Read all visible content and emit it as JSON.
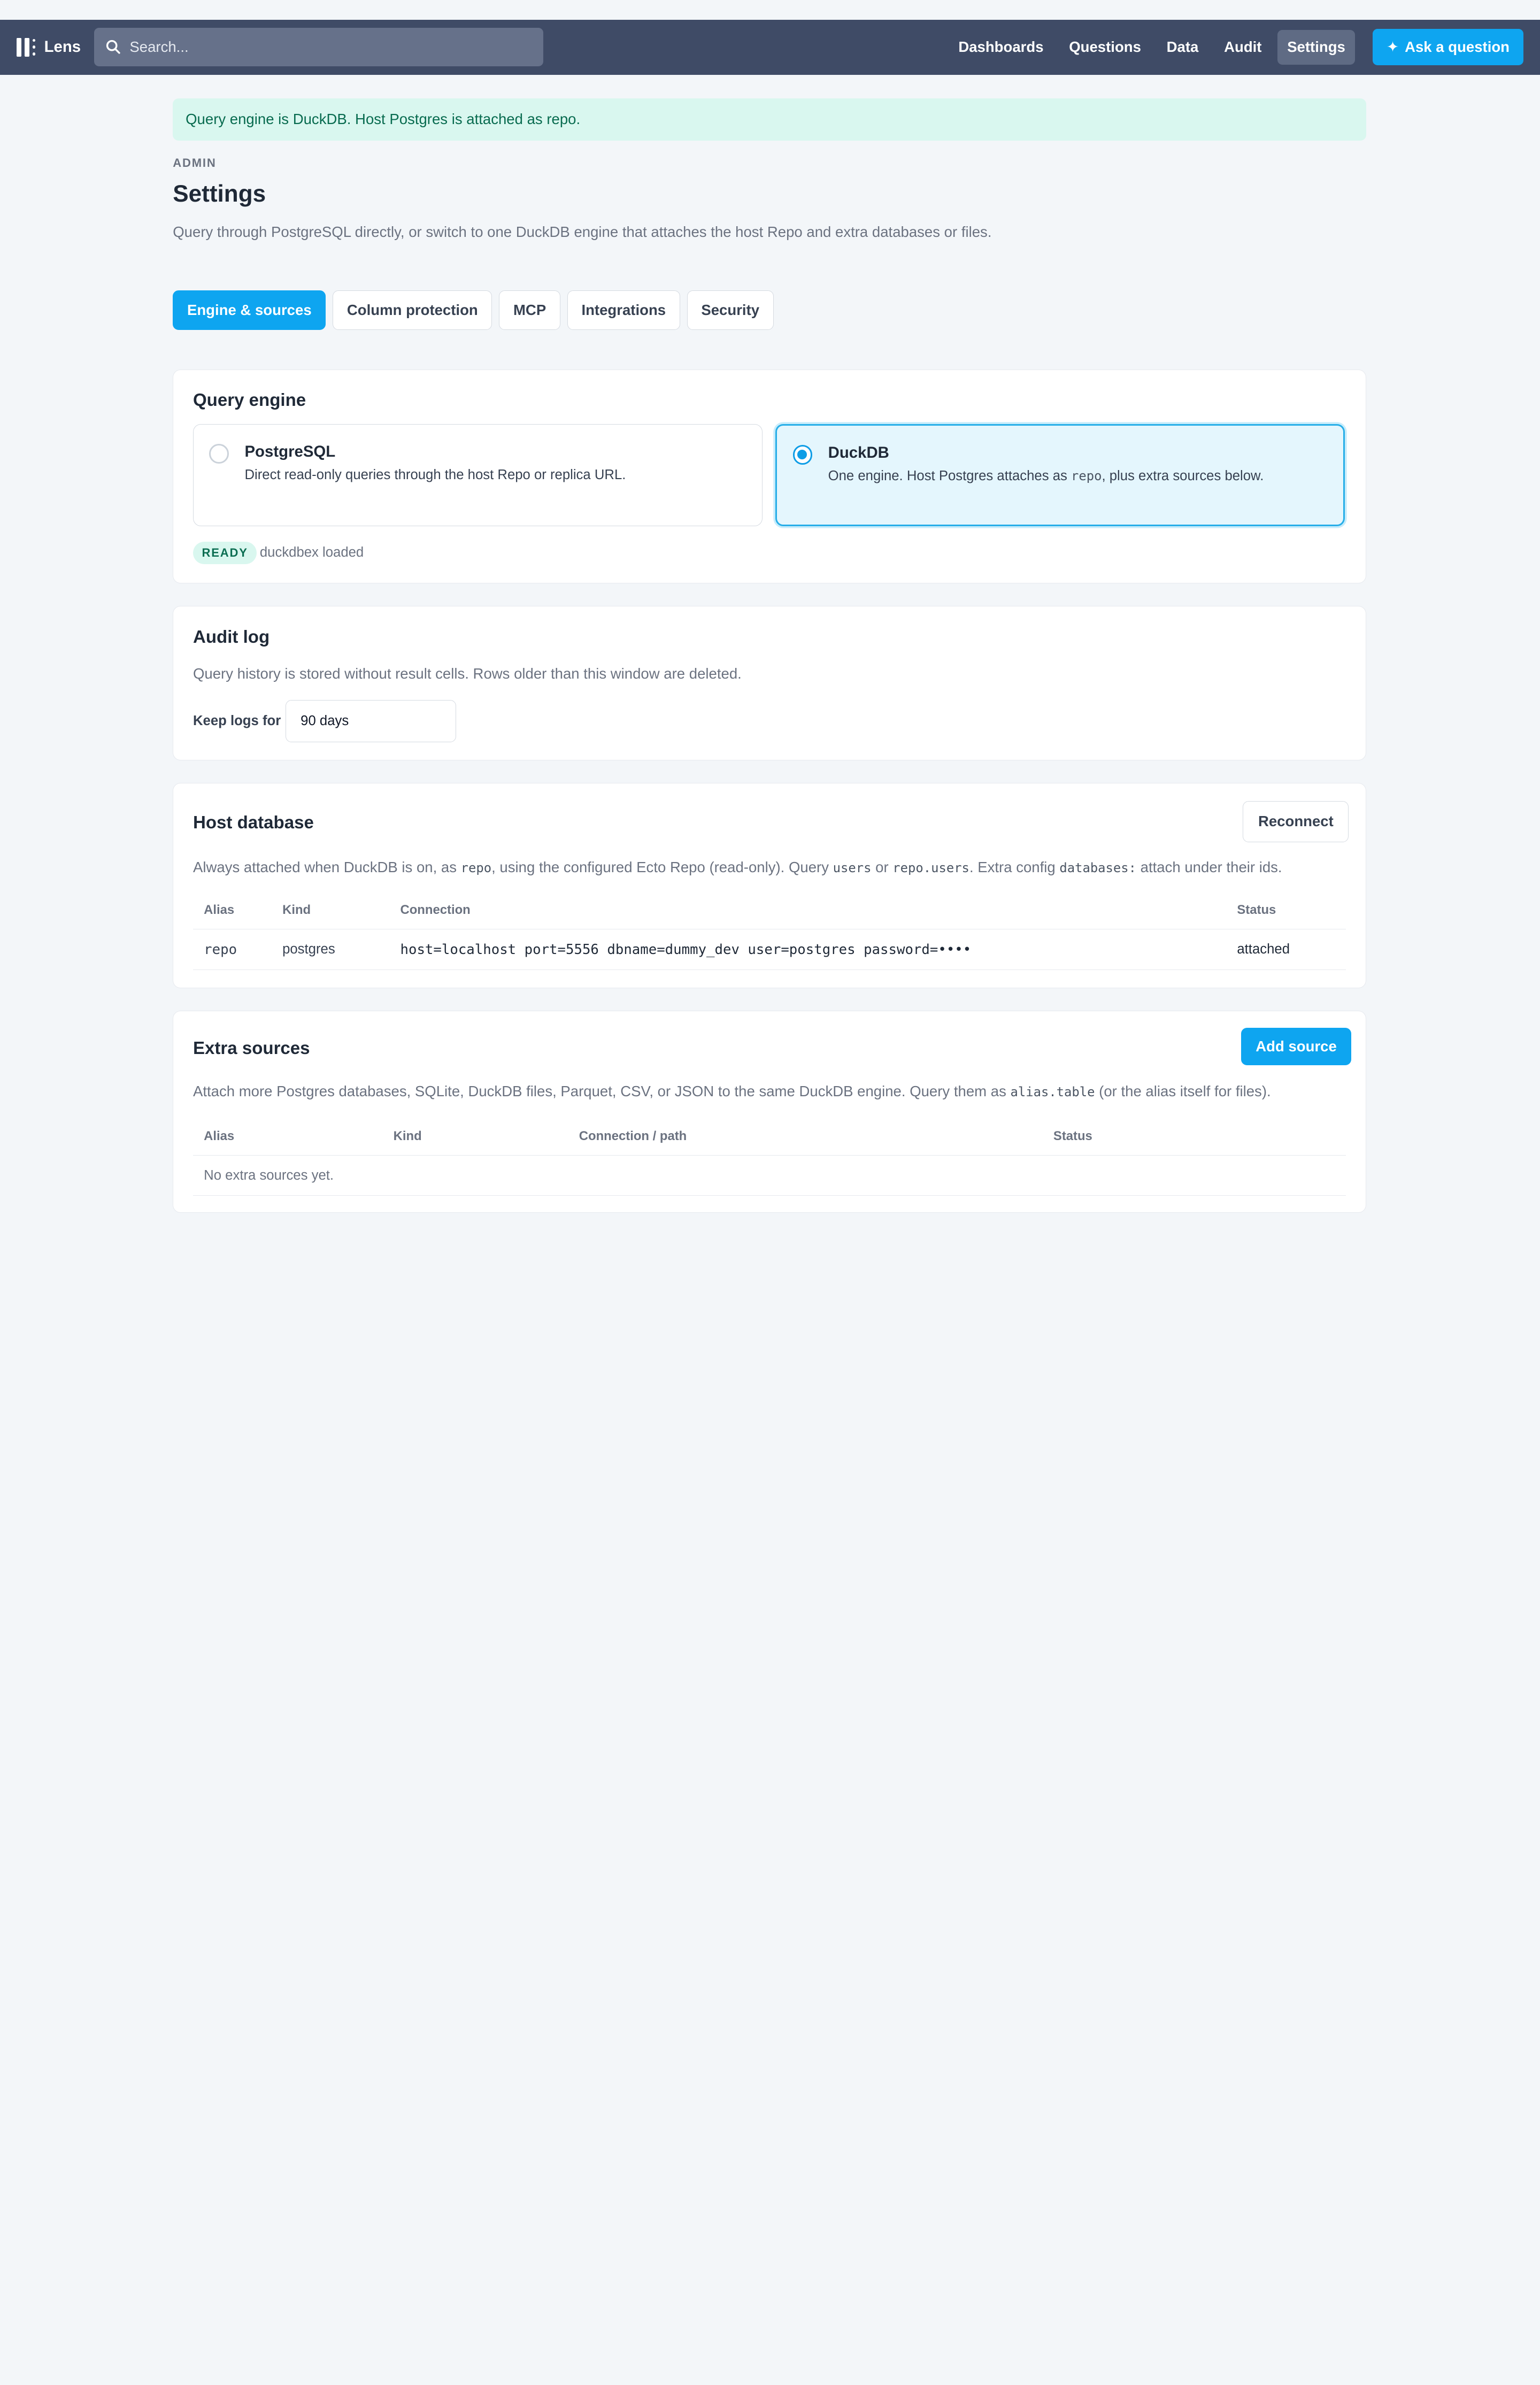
{
  "app": {
    "name": "Lens"
  },
  "search": {
    "placeholder": "Search..."
  },
  "nav": {
    "items": [
      "Dashboards",
      "Questions",
      "Data",
      "Audit",
      "Settings"
    ],
    "active": "Settings",
    "ask_label": "Ask a question"
  },
  "banner": {
    "text": "Query engine is DuckDB. Host Postgres is attached as repo."
  },
  "header": {
    "eyebrow": "ADMIN",
    "title": "Settings",
    "description": "Query through PostgreSQL directly, or switch to one DuckDB engine that attaches the host Repo and extra databases or files."
  },
  "tabs": [
    "Engine & sources",
    "Column protection",
    "MCP",
    "Integrations",
    "Security"
  ],
  "query_engine": {
    "title": "Query engine",
    "options": [
      {
        "title": "PostgreSQL",
        "desc": "Direct read-only queries through the host Repo or replica URL.",
        "selected": false
      },
      {
        "title": "DuckDB",
        "desc_before": "One engine. Host Postgres attaches as ",
        "desc_code": "repo",
        "desc_after": ", plus extra sources below.",
        "selected": true
      }
    ],
    "status_badge": "READY",
    "status_note": "duckdbex loaded"
  },
  "audit_log": {
    "title": "Audit log",
    "description": "Query history is stored without result cells. Rows older than this window are deleted.",
    "keep_label": "Keep logs for",
    "keep_value": "90 days"
  },
  "host_db": {
    "title": "Host database",
    "reconnect_label": "Reconnect",
    "desc": {
      "p1": "Always attached when DuckDB is on, as ",
      "c1": "repo",
      "p2": ", using the configured Ecto Repo (read-only). Query ",
      "c2": "users",
      "p3": " or ",
      "c3": "repo.users",
      "p4": ". Extra config ",
      "c4": "databases:",
      "p5": " attach under their ids."
    },
    "columns": [
      "Alias",
      "Kind",
      "Connection",
      "Status"
    ],
    "rows": [
      {
        "alias": "repo",
        "kind": "postgres",
        "connection": "host=localhost port=5556 dbname=dummy_dev user=postgres password=••••",
        "status": "attached"
      }
    ]
  },
  "extra_sources": {
    "title": "Extra sources",
    "add_label": "Add source",
    "desc": {
      "p1": "Attach more Postgres databases, SQLite, DuckDB files, Parquet, CSV, or JSON to the same DuckDB engine. Query them as ",
      "c1": "alias.table",
      "p2": " (or the alias itself for files)."
    },
    "columns": [
      "Alias",
      "Kind",
      "Connection / path",
      "Status"
    ],
    "empty": "No extra sources yet."
  },
  "colors": {
    "accent": "#0ea5f0",
    "topbar": "#3f4b66",
    "success_bg": "#d9f7ef",
    "success_text": "#086b4f"
  }
}
